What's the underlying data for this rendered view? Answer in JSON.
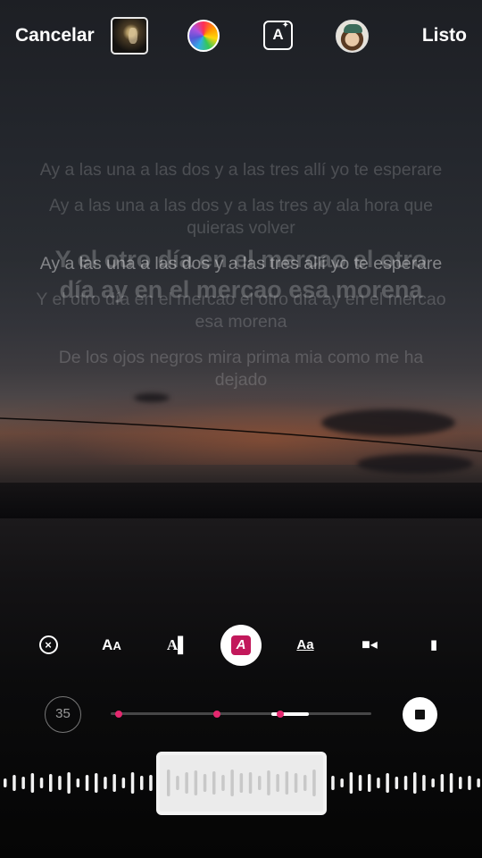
{
  "topbar": {
    "cancel_label": "Cancelar",
    "done_label": "Listo",
    "icons": [
      "album-art-icon",
      "color-wheel-icon",
      "text-effect-icon",
      "avatar-icon"
    ]
  },
  "lyrics": {
    "lines": [
      "Ay a las una a las dos y a las tres allí yo te esperare",
      "Ay a las una a las dos y a las tres ay ala hora que quieras volver",
      "Ay a las una a las dos y a las tres allí yo te esperare",
      "Y el otro día en el mercao el otro día ay en el mercao esa morena",
      "De los ojos negros mira prima mia como me ha dejado"
    ],
    "active_index": 2,
    "highlight_text": "Y el otro día en el mercao el otro día ay en el mercao esa morena"
  },
  "tools": [
    "close-circle-icon",
    "text-size-icon",
    "text-style-icon",
    "lyrics-style-selected-icon",
    "font-icon",
    "video-icon",
    "sticker-icon"
  ],
  "timeline": {
    "duration_label": "35",
    "progress_fraction": 0.76
  },
  "colors": {
    "accent": "#e4286f",
    "selected_tool": "#c2185b"
  }
}
